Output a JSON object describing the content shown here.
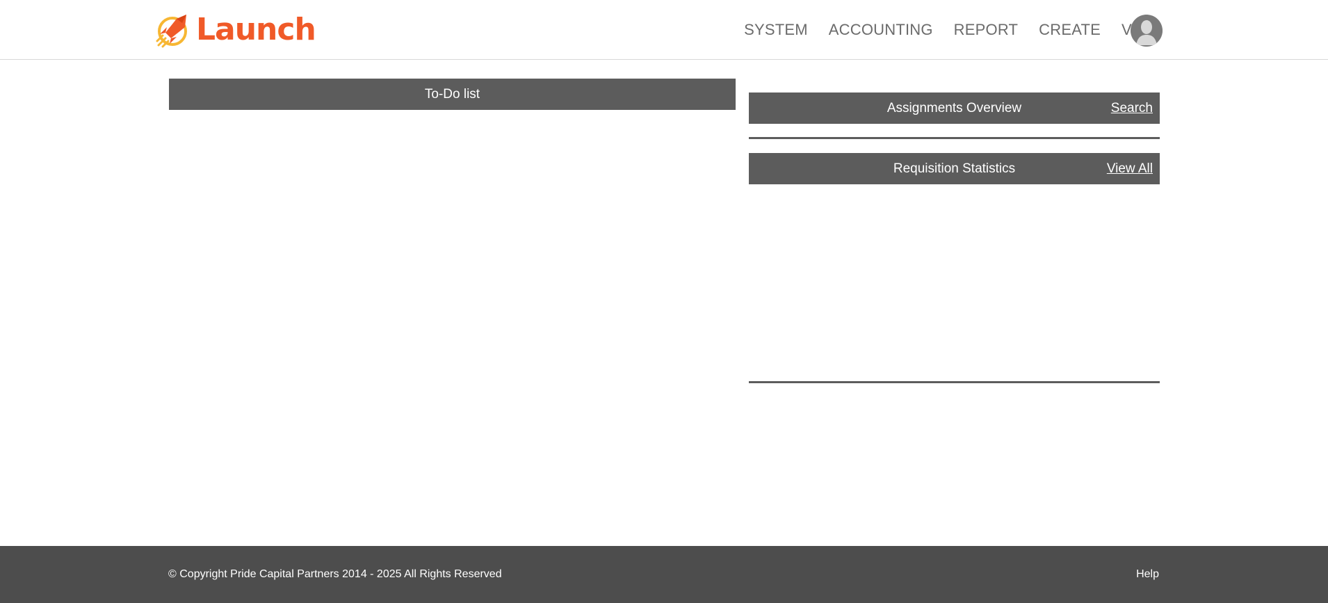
{
  "header": {
    "logo_text": "Launch",
    "brand_color": "#f05a28",
    "nav": [
      {
        "label": "SYSTEM"
      },
      {
        "label": "ACCOUNTING"
      },
      {
        "label": "REPORT"
      },
      {
        "label": "CREATE"
      },
      {
        "label": "VIEW"
      }
    ],
    "avatar_icon": "user-avatar-icon"
  },
  "todo": {
    "title": "To-Do list"
  },
  "assignments": {
    "title": "Assignments Overview",
    "link": "Search"
  },
  "requisitions": {
    "title": "Requisition Statistics",
    "link": "View All"
  },
  "footer": {
    "copyright": "© Copyright Pride Capital Partners 2014 - 2025 All Rights Reserved",
    "help": "Help"
  },
  "colors": {
    "panel_header": "#5c5c5c",
    "footer_bg": "#4d4d4d",
    "nav_text": "#6b6b6b"
  }
}
